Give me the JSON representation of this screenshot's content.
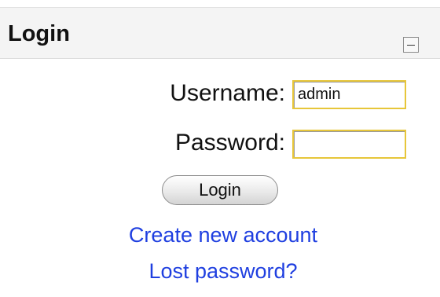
{
  "block": {
    "title": "Login",
    "collapse_icon": "minus-icon"
  },
  "form": {
    "username_label": "Username:",
    "username_value": "admin",
    "password_label": "Password:",
    "password_value": "",
    "submit_label": "Login"
  },
  "links": {
    "create_account": "Create new account",
    "lost_password": "Lost password?"
  },
  "colors": {
    "link": "#1f3fe0",
    "input_focus_border": "#e7c63a",
    "header_bg": "#f4f4f4"
  }
}
